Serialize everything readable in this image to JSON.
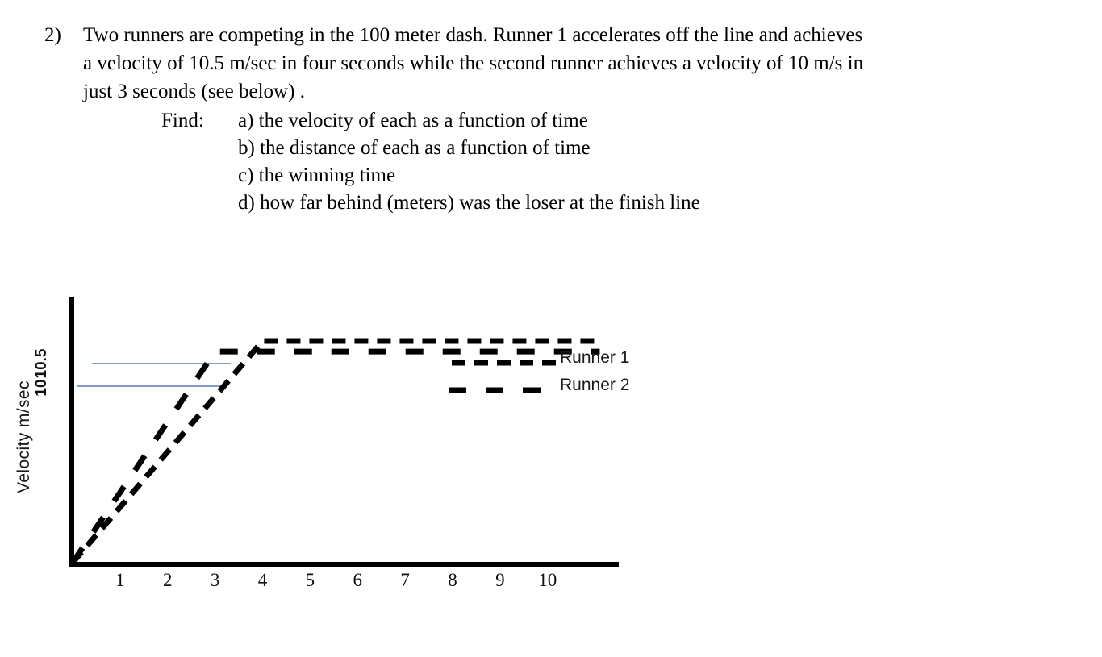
{
  "problem": {
    "number": "2)",
    "lines": [
      "Two runners are competing in the 100 meter dash.  Runner 1 accelerates off the line and achieves",
      "a velocity of 10.5 m/sec in four seconds while the second runner achieves a velocity of 10 m/s in",
      "just 3 seconds (see below) ."
    ]
  },
  "find": {
    "label": "Find:",
    "items": [
      "a) the velocity of each as a function of time",
      "b) the distance of each as a function of time",
      "c) the winning time",
      "d) how far behind (meters) was the loser at the finish line"
    ]
  },
  "chart_data": {
    "type": "line",
    "title": "",
    "xlabel": "",
    "ylabel": "Velocity  m/sec",
    "xlim": [
      0,
      11.5
    ],
    "ylim": [
      0,
      12.6
    ],
    "grid": false,
    "legend_position": "right",
    "x_tick_labels": [
      "1",
      "2",
      "3",
      "4",
      "5",
      "6",
      "7",
      "8",
      "9",
      "10"
    ],
    "x_tick_values": [
      1,
      2,
      3,
      4,
      5,
      6,
      7,
      8,
      9,
      10
    ],
    "y_tick_labels": [
      "10.5",
      "10"
    ],
    "y_tick_values": [
      10.5,
      10
    ],
    "series": [
      {
        "name": "Runner 1",
        "style": "dashed",
        "color": "#000000",
        "x": [
          0,
          4,
          11.1
        ],
        "values": [
          0,
          10.5,
          10.5
        ]
      },
      {
        "name": "Runner 2",
        "style": "dashed-long",
        "color": "#000000",
        "x": [
          0,
          3,
          11.1
        ],
        "values": [
          0,
          10,
          10
        ]
      }
    ],
    "reference_lines": [
      {
        "name": "ref-10.5",
        "y": 10.5,
        "color": "#7f9dc4",
        "x_start": 0.45,
        "x_end": 3.4
      },
      {
        "name": "ref-10",
        "y": 10,
        "color": "#7f9dc4",
        "x_start": 0.15,
        "x_end": 3.3
      }
    ],
    "legend": [
      "Runner 1",
      "Runner 2"
    ]
  }
}
